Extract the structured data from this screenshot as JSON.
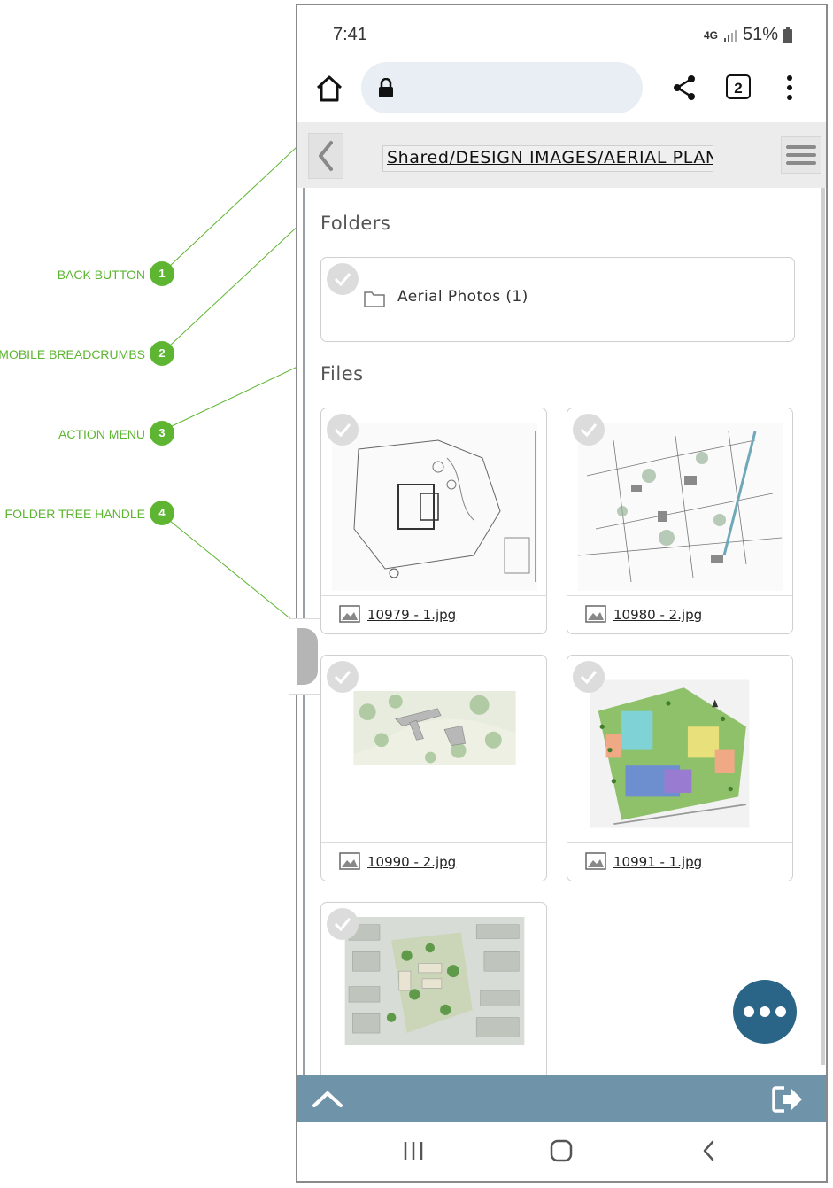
{
  "status": {
    "time": "7:41",
    "network": "4G",
    "battery": "51%"
  },
  "browser": {
    "tab_count": "2"
  },
  "appbar": {
    "breadcrumb": "Shared/DESIGN IMAGES/AERIAL PLANS"
  },
  "folders": {
    "title": "Folders",
    "items": [
      {
        "label": "Aerial Photos (1)"
      }
    ]
  },
  "files": {
    "title": "Files",
    "items": [
      {
        "name": "10979 - 1.jpg"
      },
      {
        "name": "10980 - 2.jpg"
      },
      {
        "name": "10990 - 2.jpg"
      },
      {
        "name": "10991 - 1.jpg"
      },
      {
        "name": ""
      }
    ]
  },
  "annotations": [
    {
      "number": "1",
      "label": "BACK BUTTON"
    },
    {
      "number": "2",
      "label": "MOBILE BREADCRUMBS"
    },
    {
      "number": "3",
      "label": "ACTION MENU"
    },
    {
      "number": "4",
      "label": "FOLDER TREE HANDLE"
    }
  ],
  "colors": {
    "annotation": "#5db531",
    "fab": "#2a6587",
    "bottom_bar": "#6f93a8"
  }
}
